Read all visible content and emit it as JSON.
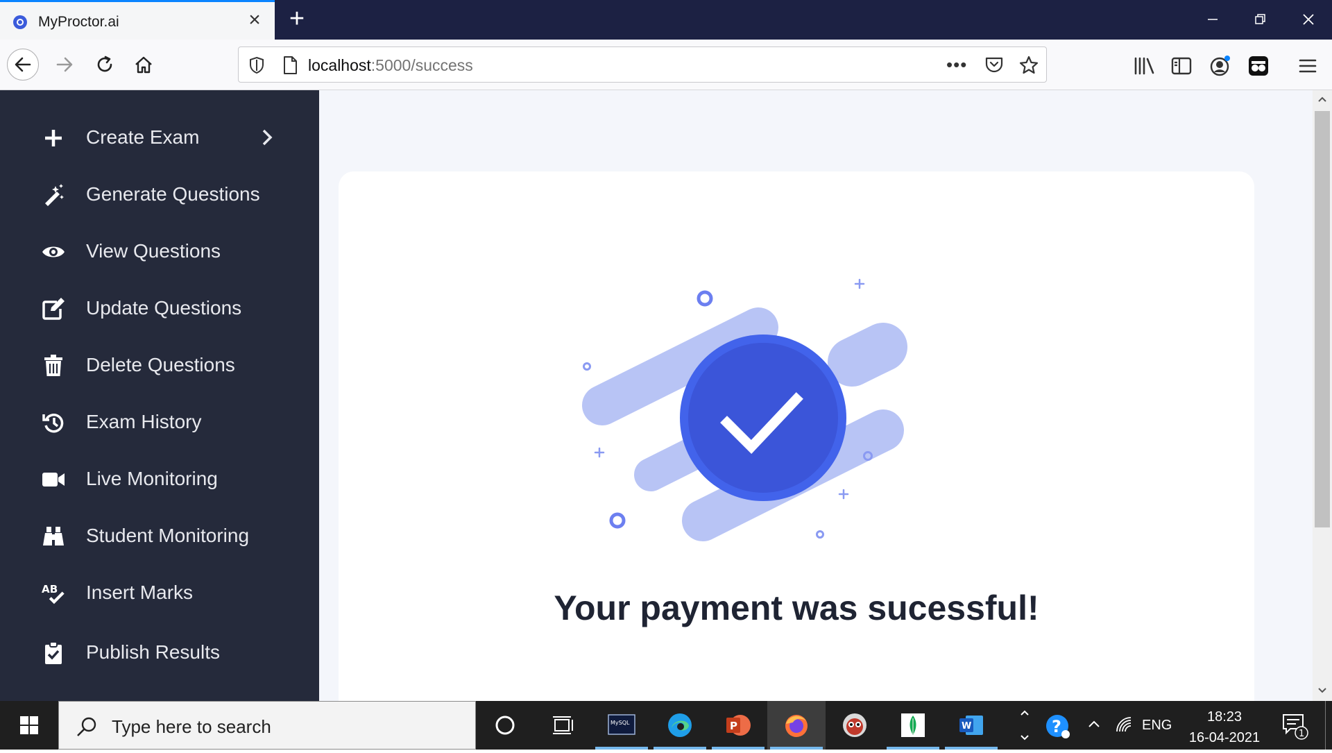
{
  "browser": {
    "tab_title": "MyProctor.ai",
    "url_host": "localhost",
    "url_path": ":5000/success"
  },
  "sidebar": {
    "items": [
      {
        "label": "Create Exam",
        "icon": "plus-icon"
      },
      {
        "label": "Generate Questions",
        "icon": "magic-wand-icon"
      },
      {
        "label": "View Questions",
        "icon": "eye-icon"
      },
      {
        "label": "Update Questions",
        "icon": "edit-icon"
      },
      {
        "label": "Delete Questions",
        "icon": "trash-icon"
      },
      {
        "label": "Exam History",
        "icon": "history-icon"
      },
      {
        "label": "Live Monitoring",
        "icon": "video-camera-icon"
      },
      {
        "label": "Student Monitoring",
        "icon": "binoculars-icon"
      },
      {
        "label": "Insert Marks",
        "icon": "spell-check-icon"
      },
      {
        "label": "Publish Results",
        "icon": "clipboard-check-icon"
      }
    ]
  },
  "main": {
    "message": "Your payment was sucessful!"
  },
  "taskbar": {
    "search_placeholder": "Type here to search",
    "mysql_label": "MySQL",
    "powerpoint_letter": "P",
    "word_letter": "W",
    "language": "ENG",
    "time": "18:23",
    "date": "16-04-2021",
    "notification_count": "1"
  },
  "colors": {
    "sidebar_bg": "#252a3b",
    "accent_blue": "#3b5bdb",
    "illustration_light": "#b8c4f5",
    "titlebar_bg": "#1c2143"
  }
}
